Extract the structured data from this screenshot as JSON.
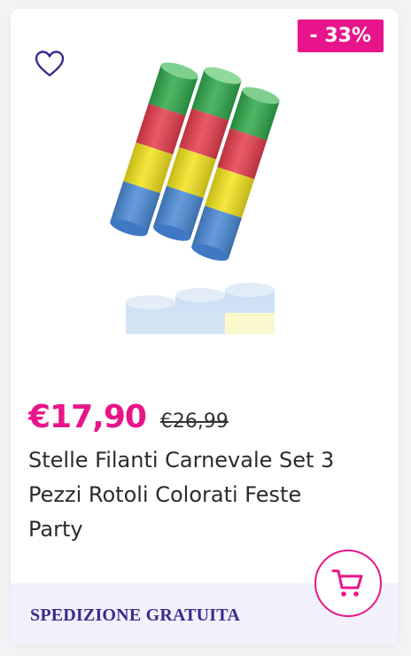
{
  "product": {
    "discount_badge": "- 33%",
    "price_current": "€17,90",
    "price_old": "€26,99",
    "title": "Stelle Filanti Carnevale Set 3 Pezzi Rotoli Colorati Feste Party",
    "shipping_label": "SPEDIZIONE GRATUITA",
    "wishlist_icon": "heart-outline-icon",
    "cart_icon": "shopping-cart-icon"
  },
  "colors": {
    "accent": "#e8158a",
    "shipping_text": "#3a2a8e",
    "shipping_bg": "#f2f0fb",
    "roll_colors": [
      "#2fa84a",
      "#e63c4c",
      "#f2e21c",
      "#4a8ad6"
    ]
  }
}
